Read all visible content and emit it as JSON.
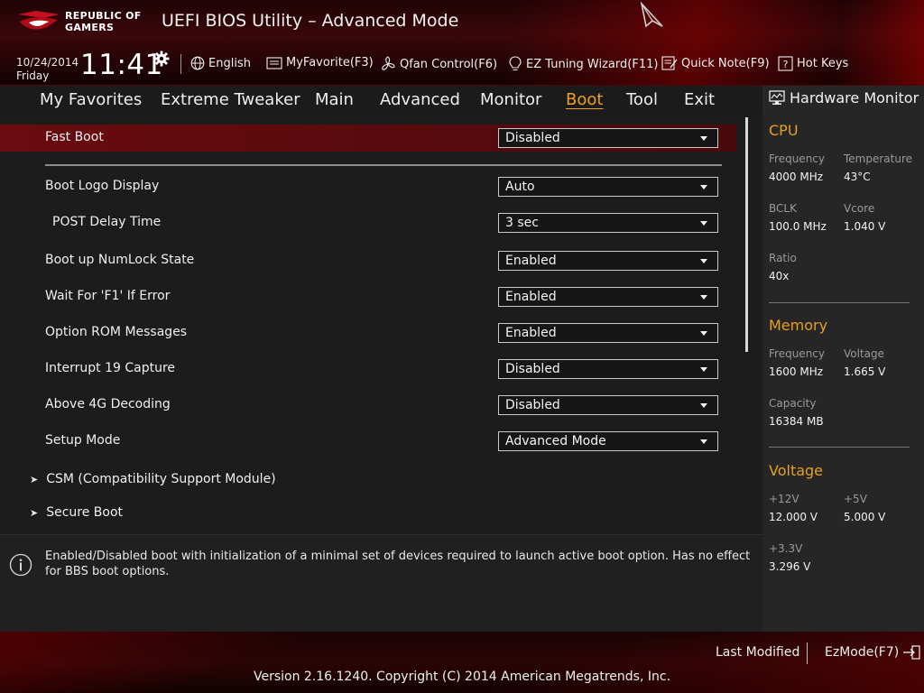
{
  "header": {
    "logo_line1": "REPUBLIC OF",
    "logo_line2": "GAMERS",
    "title": "UEFI BIOS Utility – Advanced Mode",
    "date": "10/24/2014",
    "day": "Friday",
    "time": "11:41",
    "language": "English",
    "my_favorite": "MyFavorite(F3)",
    "qfan": "Qfan Control(F6)",
    "ez_tuning": "EZ Tuning Wizard(F11)",
    "quick_note": "Quick Note(F9)",
    "hot_keys": "Hot Keys"
  },
  "tabs": [
    {
      "label": "My Favorites"
    },
    {
      "label": "Extreme Tweaker"
    },
    {
      "label": "Main"
    },
    {
      "label": "Advanced"
    },
    {
      "label": "Monitor"
    },
    {
      "label": "Boot",
      "active": true
    },
    {
      "label": "Tool"
    },
    {
      "label": "Exit"
    }
  ],
  "options": [
    {
      "label": "Fast Boot",
      "value": "Disabled"
    },
    {
      "label": "Boot Logo Display",
      "value": "Auto"
    },
    {
      "label": "POST Delay Time",
      "value": "3 sec"
    },
    {
      "label": "Boot up NumLock State",
      "value": "Enabled"
    },
    {
      "label": "Wait For 'F1' If Error",
      "value": "Enabled"
    },
    {
      "label": "Option ROM Messages",
      "value": "Enabled"
    },
    {
      "label": "Interrupt 19 Capture",
      "value": "Disabled"
    },
    {
      "label": "Above 4G Decoding",
      "value": "Disabled"
    },
    {
      "label": "Setup Mode",
      "value": "Advanced Mode"
    }
  ],
  "submenus": [
    {
      "label": "CSM (Compatibility Support Module)"
    },
    {
      "label": "Secure Boot"
    }
  ],
  "help_text": "Enabled/Disabled boot with initialization of a minimal set of devices required to launch active boot option. Has no effect for BBS boot options.",
  "hw_monitor": {
    "title": "Hardware Monitor",
    "cpu": {
      "section": "CPU",
      "frequency_label": "Frequency",
      "frequency": "4000 MHz",
      "temperature_label": "Temperature",
      "temperature": "43°C",
      "bclk_label": "BCLK",
      "bclk": "100.0 MHz",
      "vcore_label": "Vcore",
      "vcore": "1.040 V",
      "ratio_label": "Ratio",
      "ratio": "40x"
    },
    "memory": {
      "section": "Memory",
      "frequency_label": "Frequency",
      "frequency": "1600 MHz",
      "voltage_label": "Voltage",
      "voltage": "1.665 V",
      "capacity_label": "Capacity",
      "capacity": "16384 MB"
    },
    "voltage": {
      "section": "Voltage",
      "v12_label": "+12V",
      "v12": "12.000 V",
      "v5_label": "+5V",
      "v5": "5.000 V",
      "v33_label": "+3.3V",
      "v33": "3.296 V"
    }
  },
  "footer": {
    "last_modified": "Last Modified",
    "ez_mode": "EzMode(F7)",
    "copyright": "Version 2.16.1240. Copyright (C) 2014 American Megatrends, Inc."
  },
  "colors": {
    "accent": "#e8a020",
    "highlight_row": "#6a0b0f",
    "brand_red": "#8a0a0e"
  },
  "icons": [
    "rog-eye-icon",
    "cursor-icon",
    "gear-icon",
    "globe-icon",
    "favorite-icon",
    "fan-icon",
    "bulb-icon",
    "note-icon",
    "hotkeys-icon",
    "monitor-icon",
    "info-icon",
    "exit-icon"
  ]
}
